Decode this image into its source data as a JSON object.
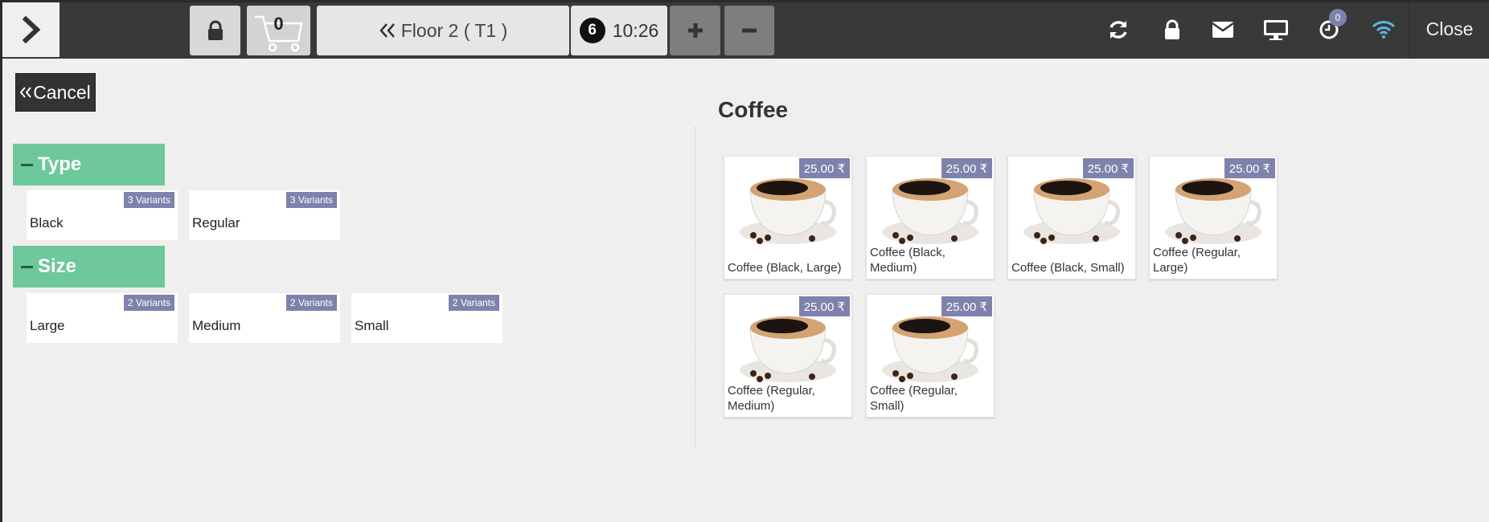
{
  "topbar": {
    "cart_count": "0",
    "floor_label": "Floor 2 ( T1 )",
    "order_number": "6",
    "order_time": "10:26",
    "notification_count": "0",
    "close_label": "Close"
  },
  "cancel_label": "Cancel",
  "attribute_groups": [
    {
      "name": "Type",
      "values": [
        {
          "label": "Black",
          "variants": "3 Variants"
        },
        {
          "label": "Regular",
          "variants": "3 Variants"
        }
      ]
    },
    {
      "name": "Size",
      "values": [
        {
          "label": "Large",
          "variants": "2 Variants"
        },
        {
          "label": "Medium",
          "variants": "2 Variants"
        },
        {
          "label": "Small",
          "variants": "2 Variants"
        }
      ]
    }
  ],
  "category_title": "Coffee",
  "products": [
    {
      "name": "Coffee (Black, Large)",
      "price": "25.00 ₹"
    },
    {
      "name": "Coffee (Black, Medium)",
      "price": "25.00 ₹"
    },
    {
      "name": "Coffee (Black, Small)",
      "price": "25.00 ₹"
    },
    {
      "name": "Coffee (Regular, Large)",
      "price": "25.00 ₹"
    },
    {
      "name": "Coffee (Regular, Medium)",
      "price": "25.00 ₹"
    },
    {
      "name": "Coffee (Regular, Small)",
      "price": "25.00 ₹"
    }
  ],
  "colors": {
    "topbar": "#393939",
    "accent": "#6ec89b",
    "badge": "#7f82ac",
    "wifi": "#5bb6e0"
  },
  "icons": [
    "chevron-right-icon",
    "lock-icon",
    "cart-icon",
    "double-chevron-left-icon",
    "plus-icon",
    "minus-icon",
    "refresh-icon",
    "lock-icon",
    "envelope-icon",
    "monitor-icon",
    "clock-icon",
    "wifi-icon"
  ]
}
